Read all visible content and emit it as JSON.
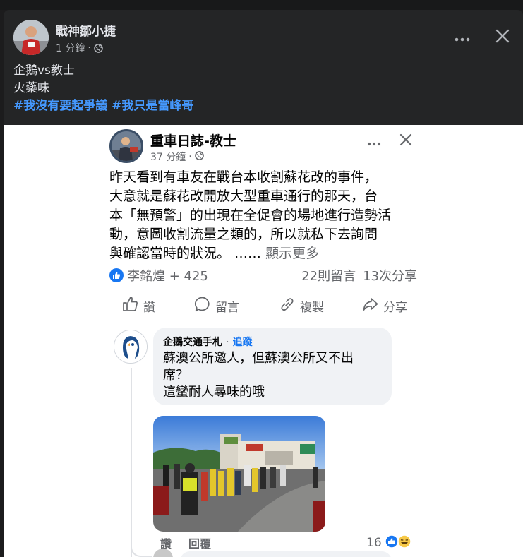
{
  "post": {
    "author": "戰神鄒小捷",
    "time": "1 分鐘",
    "time_sep": "·",
    "text_lines": [
      "企鵝vs教士",
      "火藥味"
    ],
    "hashtags": [
      "#我沒有要起爭議",
      "#我只是當峰哥"
    ]
  },
  "shared_post": {
    "author": "重車日誌-教士",
    "time": "37 分鐘",
    "time_sep": "·",
    "body_lines": [
      "昨天看到有車友在戰台本收割蘇花改的事件，",
      "大意就是蘇花改開放大型重車通行的那天，台",
      "本「無預警」的出現在全促會的場地進行造勢活",
      "動，意圖收割流量之類的，所以就私下去詢問",
      "與確認當時的狀況。 ……"
    ],
    "see_more": "顯示更多",
    "reactors": "李銘煌 + 425",
    "comments_count": "22則留言",
    "shares_count": "13次分享",
    "actions": {
      "like": "讚",
      "comment": "留言",
      "copy": "複製",
      "share": "分享"
    }
  },
  "comment": {
    "author": "企鵝交通手札",
    "sep": "·",
    "follow": "追蹤",
    "text_lines": [
      "蘇澳公所邀人，但蘇澳公所又不出",
      "席？",
      "這蠻耐人尋味的哦"
    ],
    "like": "讚",
    "reply": "回覆",
    "reaction_count": "16"
  },
  "colors": {
    "page_bg": "#242526",
    "hashtag": "#4599ff",
    "fb_blue": "#1877f2",
    "secondary_text": "#65676b"
  },
  "icons": [
    "more-icon",
    "close-icon",
    "globe-icon",
    "like-icon",
    "comment-icon",
    "copy-icon",
    "share-icon",
    "haha-emoji-icon"
  ]
}
